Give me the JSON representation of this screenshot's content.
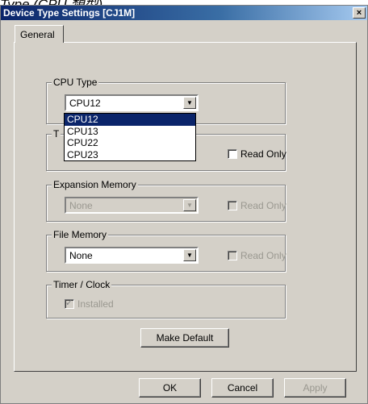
{
  "caption": "Type (CPU 類型)",
  "window": {
    "title": "Device Type Settings [CJ1M]",
    "close_glyph": "×"
  },
  "tabs": [
    {
      "label": "General"
    }
  ],
  "cpu_type": {
    "legend": "CPU Type",
    "value": "CPU12",
    "options": [
      "CPU12",
      "CPU13",
      "CPU22",
      "CPU23"
    ],
    "selected_index": 0
  },
  "program_memory": {
    "legend_prefix": "T",
    "read_only_label": "Read Only"
  },
  "expansion_memory": {
    "legend": "Expansion Memory",
    "value": "None",
    "read_only_label": "Read Only"
  },
  "file_memory": {
    "legend": "File Memory",
    "value": "None",
    "read_only_label": "Read Only"
  },
  "timer_clock": {
    "legend": "Timer / Clock",
    "installed_label": "Installed",
    "installed_checked": true
  },
  "buttons": {
    "make_default": "Make Default",
    "ok": "OK",
    "cancel": "Cancel",
    "apply": "Apply"
  },
  "icons": {
    "dropdown_arrow": "▼",
    "check": "✓"
  }
}
